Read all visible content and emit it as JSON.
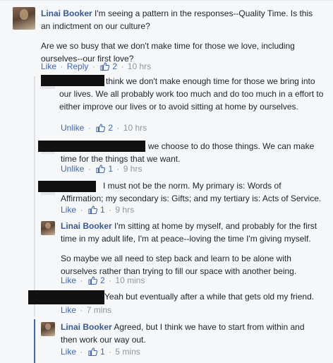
{
  "thread": {
    "comments": [
      {
        "author": "Linai Booker",
        "paragraphs": [
          "I'm seeing a pattern in the responses--Quality Time. Is this an indictment on our culture?",
          "Are we so busy that we don't make time for those we love, including ourselves--our first love?"
        ],
        "actions": {
          "like": "Like",
          "reply": "Reply",
          "likes": "2",
          "time": "10 hrs"
        }
      },
      {
        "author": "",
        "text": "I do think we don't make enough time for those we bring into our lives. We all probably work too much and do too much in a effort to either improve our lives or to avoid sitting at home by ourselves.",
        "actions": {
          "like": "Unlike",
          "likes": "2",
          "time": "10 hrs"
        }
      },
      {
        "author": "",
        "text": "we choose to do those things. We can make time for the things that we want.",
        "actions": {
          "like": "Unlike",
          "likes": "1",
          "time": "9 hrs"
        }
      },
      {
        "author": "",
        "text": "I must not be the norm. My primary is: Words of Affirmation; my secondary is: Gifts; and my tertiary is: Acts of Service.",
        "actions": {
          "like": "Like",
          "likes": "1",
          "time": "9 hrs"
        }
      },
      {
        "author": "Linai Booker",
        "paragraphs": [
          "I'm sitting at home by myself, and probably for the first time in my adult life, I'm at peace--loving the time I'm giving myself.",
          "So maybe we all need to step back and learn to be alone with ourselves rather than trying to fill our space with another being."
        ],
        "actions": {
          "like": "Like",
          "likes": "2",
          "time": "10 mins"
        }
      },
      {
        "author": "",
        "text": "Yeah but eventually after a while that gets old my friend.",
        "actions": {
          "like": "Like",
          "time": "7 mins"
        }
      },
      {
        "author": "Linai Booker",
        "text": "Agreed, but I think we have to start from within and then work our way out.",
        "actions": {
          "like": "Like",
          "likes": "1",
          "time": "5 mins"
        }
      }
    ],
    "separator": "·"
  },
  "colors": {
    "background": "#f6f7f9",
    "author_link": "#365899",
    "action_link": "#4267b2",
    "meta_gray": "#90949c",
    "redaction": "#111111",
    "thread_rail_active": "#4267b2"
  },
  "icons": {
    "like": "thumbs-up-icon",
    "avatar": "profile-photo"
  }
}
